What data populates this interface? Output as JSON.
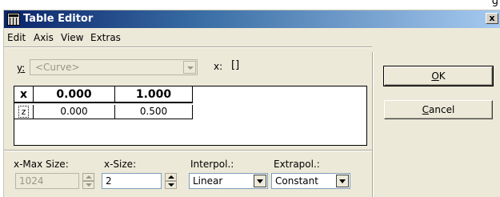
{
  "window": {
    "title": "Table Editor",
    "close_glyph": "x",
    "edge_fragment": "g"
  },
  "menu": {
    "items": [
      "Edit",
      "Axis",
      "View",
      "Extras"
    ]
  },
  "curve_selector": {
    "label_key": "y",
    "label_rest": ":",
    "value": "<Curve>",
    "x_label": "x:",
    "x_value": "[]"
  },
  "table": {
    "corner_label": "x",
    "columns": [
      "0.000",
      "1.000"
    ],
    "rows": [
      {
        "label": "z",
        "values": [
          "0.000",
          "0.500"
        ]
      }
    ]
  },
  "controls": {
    "xmax_label": "x-Max Size:",
    "xmax_value": "1024",
    "xsize_label": "x-Size:",
    "xsize_value": "2",
    "interpol_label": "Interpol.:",
    "interpol_value": "Linear",
    "extrapol_label": "Extrapol.:",
    "extrapol_value": "Constant"
  },
  "buttons": {
    "ok_mnemonic": "O",
    "ok_rest": "K",
    "cancel_mnemonic": "C",
    "cancel_rest": "ancel"
  }
}
